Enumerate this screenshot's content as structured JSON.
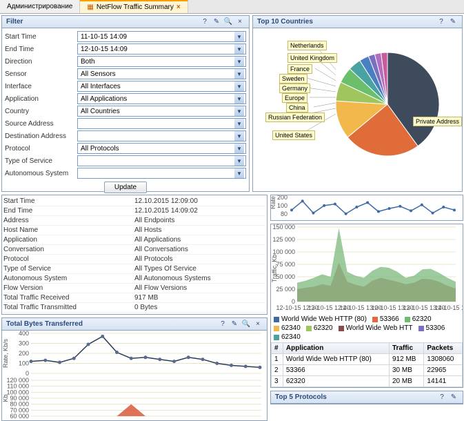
{
  "tabs": {
    "admin": "Администрирование",
    "netflow": "NetFlow Traffic Summary"
  },
  "filter": {
    "title": "Filter",
    "rows": [
      {
        "label": "Start Time",
        "value": "11-10-15 14:09"
      },
      {
        "label": "End Time",
        "value": "12-10-15 14:09"
      },
      {
        "label": "Direction",
        "value": "Both"
      },
      {
        "label": "Sensor",
        "value": "All Sensors"
      },
      {
        "label": "Interface",
        "value": "All Interfaces"
      },
      {
        "label": "Application",
        "value": "All Applications"
      },
      {
        "label": "Country",
        "value": "All Countries"
      },
      {
        "label": "Source Address",
        "value": ""
      },
      {
        "label": "Destination Address",
        "value": ""
      },
      {
        "label": "Protocol",
        "value": "All Protocols"
      },
      {
        "label": "Type of Service",
        "value": ""
      },
      {
        "label": "Autonomous System",
        "value": ""
      }
    ],
    "update": "Update"
  },
  "top_countries": {
    "title": "Top 10 Countries"
  },
  "chart_data": [
    {
      "type": "pie",
      "title": "Top 10 Countries",
      "series": [
        {
          "name": "Private Address",
          "value": 40,
          "color": "#3d4b5d"
        },
        {
          "name": "United States",
          "value": 24,
          "color": "#e06c3a"
        },
        {
          "name": "Russian Federation",
          "value": 12,
          "color": "#f2b84b"
        },
        {
          "name": "China",
          "value": 6,
          "color": "#a0c55f"
        },
        {
          "name": "Europe",
          "value": 5,
          "color": "#6bbf6b"
        },
        {
          "name": "Germany",
          "value": 4,
          "color": "#4aa3a3"
        },
        {
          "name": "Sweden",
          "value": 3,
          "color": "#4a7fc1"
        },
        {
          "name": "France",
          "value": 2,
          "color": "#7a6fc1"
        },
        {
          "name": "United Kingdom",
          "value": 2,
          "color": "#b26fc1"
        },
        {
          "name": "Netherlands",
          "value": 2,
          "color": "#c95b9b"
        }
      ]
    },
    {
      "type": "line",
      "title": "Rate, Kb/s (top sparkline)",
      "ylabel": "Rate, Kb",
      "ylim": [
        80,
        200
      ],
      "x": [
        "12-10-15 12:30",
        "12-10-15 12:40",
        "12-10-15 13:00",
        "12-10-15 13:30",
        "12-10-15 13:40",
        "12-10-15 14:00"
      ],
      "values": [
        120,
        180,
        100,
        150,
        160,
        95,
        140,
        170,
        110,
        130,
        145,
        115,
        155,
        100,
        140,
        120
      ]
    },
    {
      "type": "area",
      "title": "Traffic, Kb",
      "ylabel": "Traffic, Kb",
      "xlabel": "",
      "ylim": [
        0,
        150000
      ],
      "yticks": [
        0,
        25000,
        50000,
        75000,
        100000,
        125000,
        150000
      ],
      "x": [
        "12-10-15 12:30",
        "12-10-15 12:40",
        "12-10-15 13:00",
        "12-10-15 13:30",
        "12-10-15 13:40",
        "12-10-15 14:00"
      ],
      "series": [
        {
          "name": "green",
          "color": "#7cb97c",
          "values": [
            38000,
            42000,
            48000,
            55000,
            50000,
            148000,
            60000,
            52000,
            48000,
            62000,
            70000,
            68000,
            60000,
            48000,
            52000,
            65000,
            66000,
            58000,
            48000,
            40000
          ]
        },
        {
          "name": "red",
          "color": "#b35a5a",
          "values": [
            25000,
            28000,
            30000,
            35000,
            32000,
            78000,
            40000,
            34000,
            30000,
            42000,
            48000,
            44000,
            40000,
            35000,
            38000,
            46000,
            45000,
            40000,
            32000,
            26000
          ]
        }
      ]
    },
    {
      "type": "line",
      "title": "Total Bytes Transferred — Rate, Kb/s",
      "ylabel": "Rate, Kb/s",
      "ylim": [
        0,
        400
      ],
      "yticks": [
        0,
        100,
        200,
        300,
        400
      ],
      "values": [
        120,
        130,
        110,
        150,
        290,
        370,
        210,
        150,
        160,
        140,
        120,
        160,
        140,
        100,
        80,
        70,
        60
      ]
    },
    {
      "type": "area",
      "title": "Total Bytes Transferred — Kb",
      "ylabel": "Kb",
      "ylim": [
        60000,
        120000
      ],
      "yticks": [
        60000,
        70000,
        80000,
        90000,
        100000,
        110000,
        120000
      ],
      "series": [
        {
          "name": "red",
          "color": "#d85a3a",
          "values": [
            0,
            0,
            0,
            0,
            0,
            0,
            10000,
            80000,
            10000,
            0,
            0,
            0,
            0,
            0,
            0,
            0,
            0
          ]
        }
      ]
    }
  ],
  "summary": [
    {
      "k": "Start Time",
      "v": "12.10.2015 12:09:00"
    },
    {
      "k": "End Time",
      "v": "12.10.2015 14:09:02"
    },
    {
      "k": "Address",
      "v": "All Endpoints"
    },
    {
      "k": "Host Name",
      "v": "All Hosts"
    },
    {
      "k": "Application",
      "v": "All Applications"
    },
    {
      "k": "Conversation",
      "v": "All Conversations"
    },
    {
      "k": "Protocol",
      "v": "All Protocols"
    },
    {
      "k": "Type of Service",
      "v": "All Types Of Service"
    },
    {
      "k": "Autonomous System",
      "v": "All Autonomous Systems"
    },
    {
      "k": "Flow Version",
      "v": "All Flow Versions"
    },
    {
      "k": "Total Traffic Received",
      "v": "917 MB"
    },
    {
      "k": "Total Traffic Transmitted",
      "v": "0 Bytes"
    }
  ],
  "bytes_panel": {
    "title": "Total Bytes Transferred"
  },
  "traffic_legend": [
    {
      "label": "World Wide Web HTTP (80)",
      "color": "#3d6aa3"
    },
    {
      "label": "53366",
      "color": "#e06c3a"
    },
    {
      "label": "62320",
      "color": "#6bbf6b"
    },
    {
      "label": "62340",
      "color": "#f2b84b"
    },
    {
      "label": "62320",
      "color": "#a0c55f"
    },
    {
      "label": "World Wide Web HTT",
      "color": "#8a4a4a"
    },
    {
      "label": "53306",
      "color": "#7a6fc1"
    },
    {
      "label": "62340",
      "color": "#4aa3a3"
    }
  ],
  "app_table": {
    "headers": [
      "#",
      "Application",
      "Traffic",
      "Packets"
    ],
    "rows": [
      [
        "1",
        "World Wide Web HTTP (80)",
        "912 MB",
        "1308060"
      ],
      [
        "2",
        "53366",
        "30 MB",
        "22965"
      ],
      [
        "3",
        "62320",
        "20 MB",
        "14141"
      ]
    ]
  },
  "top5": {
    "title": "Top 5 Protocols"
  },
  "pie_labels": [
    "Netherlands",
    "United Kingdom",
    "France",
    "Sweden",
    "Germany",
    "Europe",
    "China",
    "Russian Federation",
    "United States",
    "Private Address"
  ]
}
